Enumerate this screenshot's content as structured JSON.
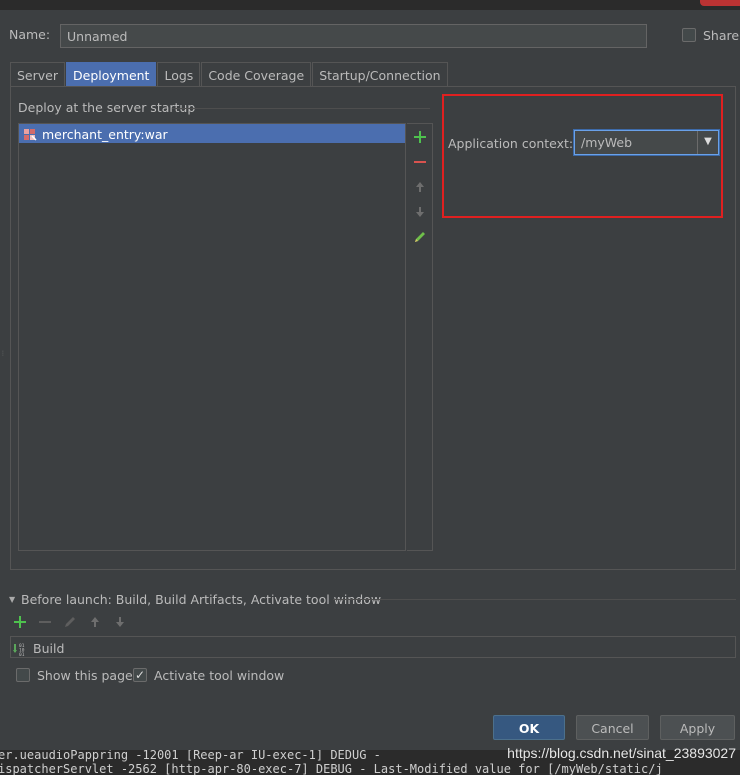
{
  "dialog": {
    "name_label": "Name:",
    "name_value": "Unnamed",
    "share_label": "Share"
  },
  "tabs": [
    {
      "label": "Server",
      "active": false
    },
    {
      "label": "Deployment",
      "active": true
    },
    {
      "label": "Logs",
      "active": false
    },
    {
      "label": "Code Coverage",
      "active": false
    },
    {
      "label": "Startup/Connection",
      "active": false
    }
  ],
  "deployment": {
    "section_label": "Deploy at the server startup",
    "items": [
      {
        "label": "merchant_entry:war",
        "icon": "war-artifact-icon",
        "selected": true
      }
    ],
    "toolbar": {
      "add_icon": "plus-icon",
      "remove_icon": "minus-icon",
      "up_icon": "arrow-up-icon",
      "down_icon": "arrow-down-icon",
      "edit_icon": "pencil-icon"
    },
    "context_label": "Application context:",
    "context_value": "/myWeb",
    "highlight_color": "#e02020"
  },
  "before_launch": {
    "label": "Before launch: Build, Build Artifacts, Activate tool window",
    "items": [
      {
        "label": "Build",
        "icon": "build-icon"
      }
    ]
  },
  "options": {
    "show_page_label": "Show this page",
    "show_page_checked": false,
    "activate_label": "Activate tool window",
    "activate_checked": true
  },
  "buttons": {
    "ok": "OK",
    "cancel": "Cancel",
    "apply": "Apply"
  },
  "console": {
    "line1": "er.ueaudioPappring -12001 [Reep-ar IU-exec-1] DEDUG -",
    "line2": "ispatcherServlet -2562 [http-apr-80-exec-7] DEBUG  - Last-Modified value for [/myWeb/static/j"
  },
  "watermark": "https://blog.csdn.net/sinat_23893027"
}
